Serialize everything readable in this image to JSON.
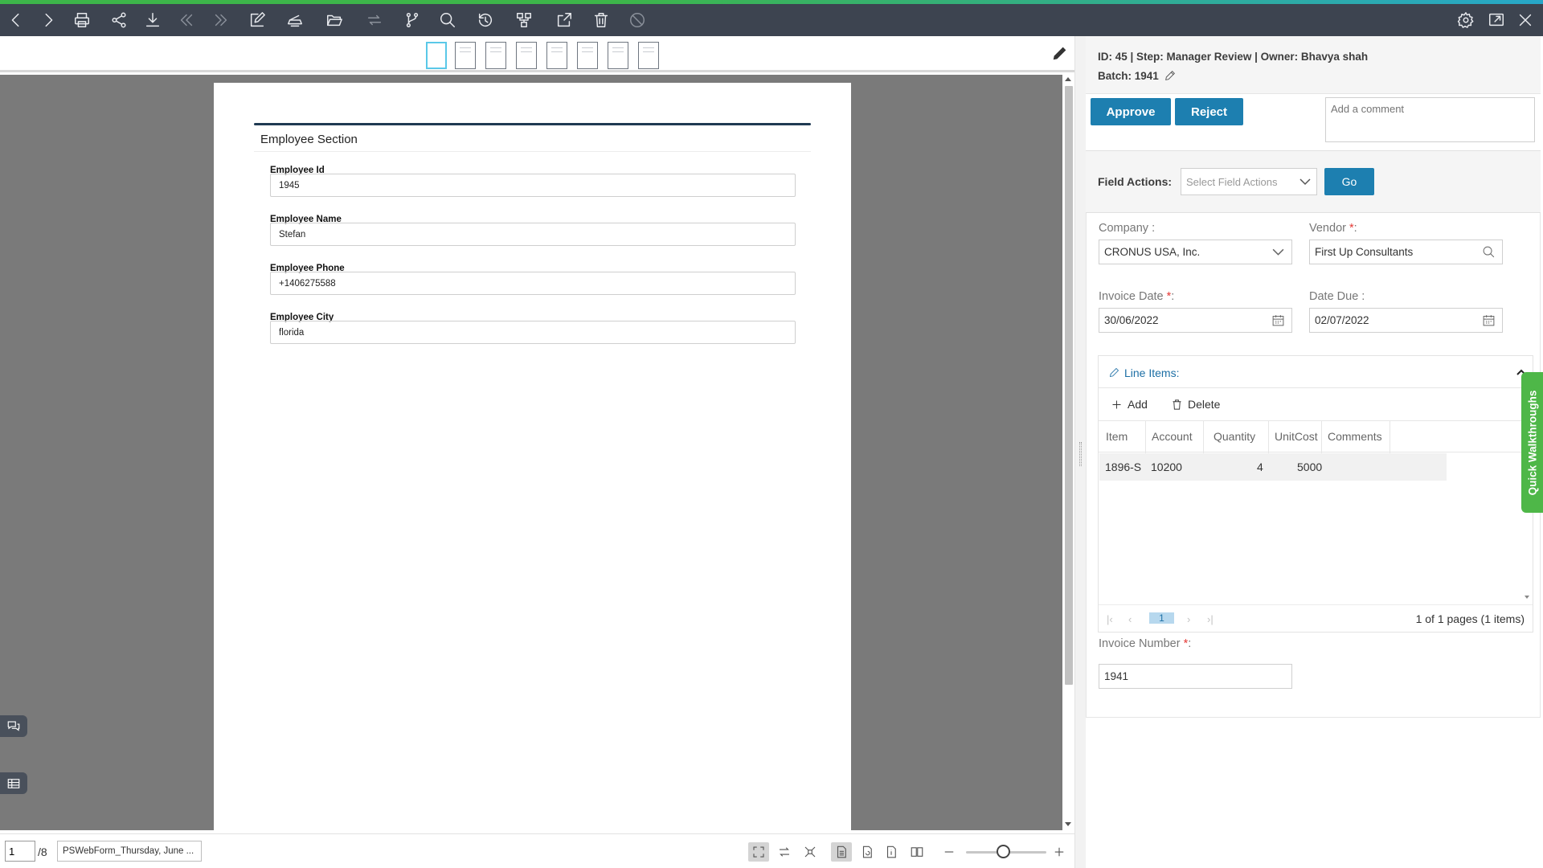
{
  "colors": {
    "toolbar": "#3d4450",
    "primary": "#1d7fb0",
    "accent_green": "#4eb748",
    "link_blue": "#1d6fa5",
    "required": "#e53935"
  },
  "toolbar": {
    "left_icons": [
      "back-icon",
      "forward-icon",
      "print-icon",
      "share-icon",
      "download-icon",
      "first-icon",
      "last-icon",
      "edit-icon",
      "scan-icon",
      "open-folder-icon",
      "route-icon",
      "branch-icon",
      "search-icon",
      "history-icon",
      "workflow-icon",
      "export-icon",
      "delete-icon",
      "block-icon"
    ],
    "right_icons": [
      "gear-icon",
      "maximize-icon",
      "close-icon"
    ]
  },
  "thumbnails": {
    "count": 8,
    "active_index": 0
  },
  "document": {
    "section_title": "Employee Section",
    "fields": [
      {
        "label": "Employee Id",
        "value": "1945"
      },
      {
        "label": "Employee Name",
        "value": "Stefan"
      },
      {
        "label": "Employee Phone",
        "value": "+1406275588"
      },
      {
        "label": "Employee City",
        "value": "florida"
      }
    ]
  },
  "bottom_bar": {
    "page_current": "1",
    "page_total": "/8",
    "doc_name": "PSWebForm_Thursday, June ..."
  },
  "panel": {
    "header_line1": "ID: 45 | Step: Manager Review | Owner: Bhavya shah",
    "batch_label": "Batch: 1941",
    "approve_label": "Approve",
    "reject_label": "Reject",
    "comment_placeholder": "Add a comment",
    "field_actions_label": "Field Actions:",
    "field_actions_placeholder": "Select Field Actions",
    "go_label": "Go",
    "company_label": "Company :",
    "company_value": "CRONUS USA, Inc.",
    "vendor_label": "Vendor",
    "vendor_value": "First Up Consultants",
    "invoice_date_label": "Invoice Date",
    "invoice_date_value": "30/06/2022",
    "date_due_label": "Date Due :",
    "date_due_value": "02/07/2022",
    "required_mark": "*",
    "colon": ":",
    "line_items": {
      "title": "Line Items:",
      "add_label": "Add",
      "delete_label": "Delete",
      "columns": [
        "Item",
        "Account",
        "Quantity",
        "UnitCost",
        "Comments"
      ],
      "rows": [
        {
          "item": "1896-S",
          "account": "10200",
          "quantity": "4",
          "unitcost": "5000",
          "comments": ""
        }
      ],
      "pager_page": "1",
      "pager_info": "1 of 1 pages (1 items)"
    },
    "invoice_number_label": "Invoice Number",
    "invoice_number_value": "1941",
    "quick_walkthroughs": "Quick Walkthroughs"
  }
}
